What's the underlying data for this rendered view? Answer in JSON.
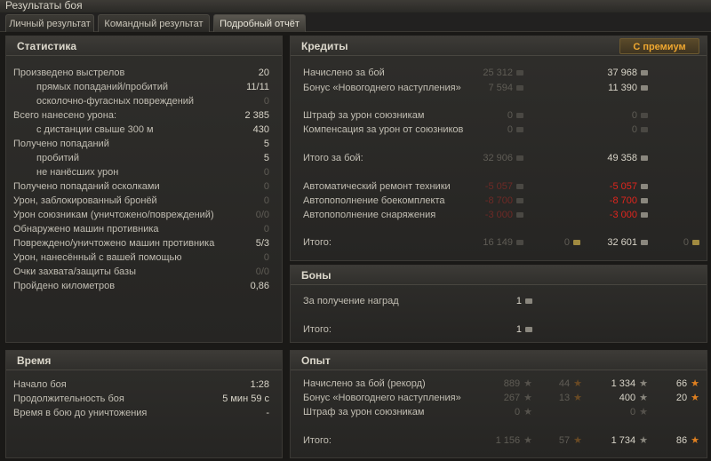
{
  "window_title": "Результаты боя",
  "tabs": [
    "Личный результат",
    "Командный результат",
    "Подробный отчёт"
  ],
  "stats": {
    "title": "Статистика",
    "rows": [
      {
        "label": "Произведено выстрелов",
        "value": "20"
      },
      {
        "label": "прямых попаданий/пробитий",
        "value": "11/11"
      },
      {
        "label": "осколочно-фугасных повреждений",
        "value": "0"
      },
      {
        "label": "Всего нанесено урона:",
        "value": "2 385"
      },
      {
        "label": "с дистанции свыше 300 м",
        "value": "430"
      },
      {
        "label": "Получено попаданий",
        "value": "5"
      },
      {
        "label": "пробитий",
        "value": "5"
      },
      {
        "label": "не нанёсших урон",
        "value": "0"
      },
      {
        "label": "Получено попаданий осколками",
        "value": "0"
      },
      {
        "label": "Урон, заблокированный бронёй",
        "value": "0"
      },
      {
        "label": "Урон союзникам (уничтожено/повреждений)",
        "value": "0/0"
      },
      {
        "label": "Обнаружено машин противника",
        "value": "0"
      },
      {
        "label": "Повреждено/уничтожено машин противника",
        "value": "5/3"
      },
      {
        "label": "Урон, нанесённый с вашей помощью",
        "value": "0"
      },
      {
        "label": "Очки захвата/защиты базы",
        "value": "0/0"
      },
      {
        "label": "Пройдено километров",
        "value": "0,86"
      }
    ]
  },
  "time": {
    "title": "Время",
    "rows": [
      {
        "label": "Начало боя",
        "value": "1:28"
      },
      {
        "label": "Продолжительность боя",
        "value": "5 мин 59 с"
      },
      {
        "label": "Время в бою до уничтожения",
        "value": "-"
      }
    ]
  },
  "credits": {
    "title": "Кредиты",
    "premium_label": "С премиум",
    "rows": [
      {
        "label": "Начислено за бой",
        "base": "25 312",
        "prem": "37 968"
      },
      {
        "label": "Бонус «Новогоднего наступления»",
        "base": "7 594",
        "prem": "11 390"
      },
      {
        "label": "Штраф за урон союзникам",
        "base": "0",
        "prem": "0"
      },
      {
        "label": "Компенсация за урон от союзников",
        "base": "0",
        "prem": "0"
      },
      {
        "label": "Итого за бой:",
        "base": "32 906",
        "prem": "49 358"
      },
      {
        "label": "Автоматический ремонт техники",
        "base": "-5 057",
        "prem": "-5 057"
      },
      {
        "label": "Автопополнение боекомплекта",
        "base": "-8 700",
        "prem": "-8 700"
      },
      {
        "label": "Автопополнение снаряжения",
        "base": "-3 000",
        "prem": "-3 000"
      },
      {
        "label": "Итого:",
        "base": "16 149",
        "base_gold": "0",
        "prem": "32 601",
        "prem_gold": "0"
      }
    ]
  },
  "bonds": {
    "title": "Боны",
    "rows": [
      {
        "label": "За получение наград",
        "value": "1"
      },
      {
        "label": "Итого:",
        "value": "1"
      }
    ]
  },
  "xp": {
    "title": "Опыт",
    "rows": [
      {
        "label": "Начислено за бой (рекорд)",
        "base": "889",
        "base_free": "44",
        "prem": "1 334",
        "prem_free": "66"
      },
      {
        "label": "Бонус «Новогоднего наступления»",
        "base": "267",
        "base_free": "13",
        "prem": "400",
        "prem_free": "20"
      },
      {
        "label": "Штраф за урон союзникам",
        "base": "0",
        "base_free": "",
        "prem": "0",
        "prem_free": ""
      },
      {
        "label": "Итого:",
        "base": "1 156",
        "base_free": "57",
        "prem": "1 734",
        "prem_free": "86"
      }
    ]
  }
}
